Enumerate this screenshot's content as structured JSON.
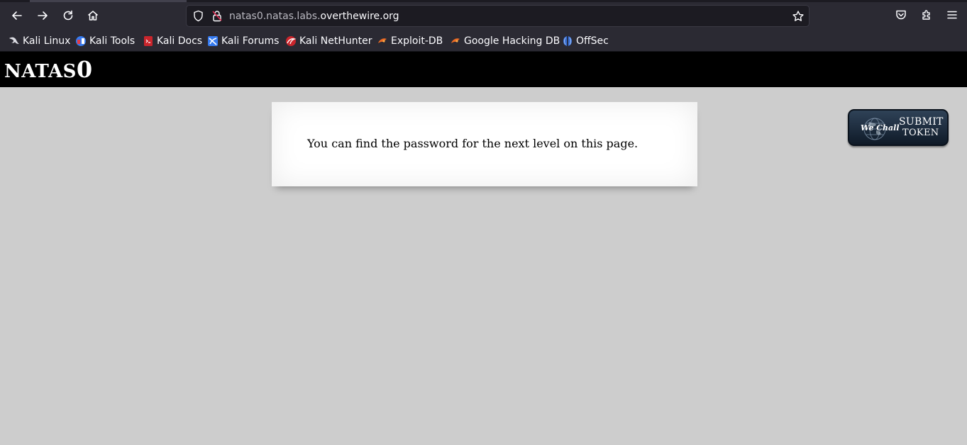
{
  "browser": {
    "url_prefix": "natas0.natas.labs.",
    "url_domain": "overthewire.org",
    "bookmarks": [
      {
        "label": "Kali Linux",
        "icon": "kali-dragon-icon"
      },
      {
        "label": "Kali Tools",
        "icon": "kali-tools-icon"
      },
      {
        "label": "Kali Docs",
        "icon": "kali-docs-icon"
      },
      {
        "label": "Kali Forums",
        "icon": "kali-forums-icon"
      },
      {
        "label": "Kali NetHunter",
        "icon": "kali-nethunter-icon"
      },
      {
        "label": "Exploit-DB",
        "icon": "exploit-db-icon"
      },
      {
        "label": "Google Hacking DB",
        "icon": "ghdb-icon"
      },
      {
        "label": "OffSec",
        "icon": "offsec-icon"
      }
    ]
  },
  "page": {
    "title_main": "NATAS",
    "title_num": "0",
    "message": "You can find the password for the next level on this page.",
    "wechall": {
      "logo": "We Chall",
      "line1": "SUBMIT",
      "line2": "TOKEN"
    }
  },
  "colors": {
    "chrome": "#2b2a33",
    "urlbar": "#1c1b22",
    "page_bg": "#cdcdcd",
    "header_bg": "#000000"
  }
}
